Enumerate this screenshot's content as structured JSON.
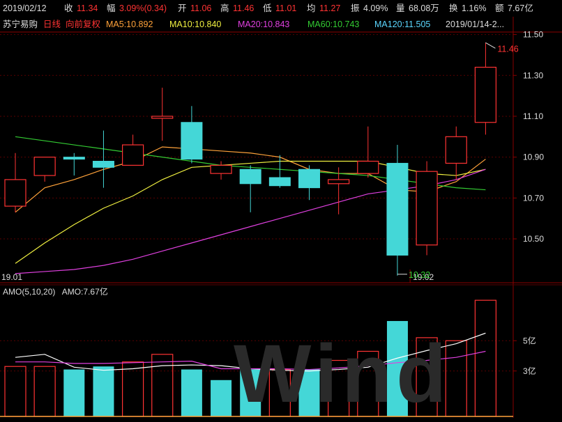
{
  "header": {
    "date": "2019/02/12",
    "close_label": "收",
    "close_value": "11.34",
    "change_label": "幅",
    "change_value": "3.09%(0.34)",
    "open_label": "开",
    "open_value": "11.06",
    "high_label": "高",
    "high_value": "11.46",
    "low_label": "低",
    "low_value": "11.01",
    "avg_label": "均",
    "avg_value": "11.27",
    "amp_label": "振",
    "amp_value": "4.09%",
    "vol_label": "量",
    "vol_value": "68.08万",
    "turn_label": "换",
    "turn_value": "1.16%",
    "amt_label": "额",
    "amt_value": "7.67亿"
  },
  "ma_bar": {
    "stock_name": "苏宁易购",
    "period": "日线",
    "adjust": "向前复权",
    "ma5": "MA5:10.892",
    "ma10": "MA10:10.840",
    "ma20": "MA20:10.843",
    "ma60": "MA60:10.743",
    "ma120": "MA120:11.505",
    "range": "2019/01/14-2..."
  },
  "amo_bar": {
    "params": "AMO(5,10,20)",
    "value": "AMO:7.67亿"
  },
  "annotations": {
    "high_marker": "11.46",
    "low_marker": "10.32"
  },
  "watermark": "Wind",
  "colors": {
    "up": "#ff3333",
    "down": "#44d7d7",
    "ma5": "#ffa23a",
    "ma10": "#f0f040",
    "ma20": "#e040e0",
    "ma60": "#33cc33",
    "ma120": "#5bd7ff",
    "grid": "#5a0000",
    "axis_text": "#dddddd"
  },
  "chart_data": [
    {
      "type": "candlestick",
      "title": "",
      "xlabel": "",
      "ylabel": "",
      "ylim": [
        10.35,
        11.56
      ],
      "y_ticks": [
        "11.50",
        "11.30",
        "11.10",
        "10.90",
        "10.70",
        "10.50"
      ],
      "x_tick_labels": [
        {
          "index": 0,
          "label": "19.01"
        },
        {
          "index": 14,
          "label": "19.02"
        }
      ],
      "candles": [
        {
          "open": 10.66,
          "close": 10.79,
          "high": 10.92,
          "low": 10.63
        },
        {
          "open": 10.81,
          "close": 10.9,
          "high": 10.9,
          "low": 10.78
        },
        {
          "open": 10.9,
          "close": 10.89,
          "high": 10.92,
          "low": 10.81
        },
        {
          "open": 10.88,
          "close": 10.85,
          "high": 11.03,
          "low": 10.75
        },
        {
          "open": 10.86,
          "close": 10.96,
          "high": 11.01,
          "low": 10.86
        },
        {
          "open": 11.09,
          "close": 11.1,
          "high": 11.24,
          "low": 10.98
        },
        {
          "open": 11.07,
          "close": 10.89,
          "high": 11.15,
          "low": 10.87
        },
        {
          "open": 10.82,
          "close": 10.86,
          "high": 10.88,
          "low": 10.79
        },
        {
          "open": 10.84,
          "close": 10.77,
          "high": 10.86,
          "low": 10.63
        },
        {
          "open": 10.8,
          "close": 10.76,
          "high": 10.91,
          "low": 10.75
        },
        {
          "open": 10.84,
          "close": 10.75,
          "high": 10.86,
          "low": 10.69
        },
        {
          "open": 10.77,
          "close": 10.79,
          "high": 10.85,
          "low": 10.62
        },
        {
          "open": 10.82,
          "close": 10.88,
          "high": 11.05,
          "low": 10.8
        },
        {
          "open": 10.87,
          "close": 10.42,
          "high": 10.96,
          "low": 10.32
        },
        {
          "open": 10.47,
          "close": 10.83,
          "high": 10.88,
          "low": 10.42
        },
        {
          "open": 10.87,
          "close": 11.0,
          "high": 11.05,
          "low": 10.79
        },
        {
          "open": 11.07,
          "close": 11.34,
          "high": 11.46,
          "low": 11.01
        }
      ],
      "ma_series": [
        {
          "name": "MA5",
          "values": [
            10.63,
            10.75,
            10.79,
            10.84,
            10.88,
            10.95,
            10.94,
            10.93,
            10.92,
            10.9,
            10.84,
            10.82,
            10.82,
            10.74,
            10.73,
            10.78,
            10.89
          ]
        },
        {
          "name": "MA10",
          "values": [
            10.38,
            10.48,
            10.57,
            10.65,
            10.71,
            10.79,
            10.85,
            10.86,
            10.87,
            10.88,
            10.88,
            10.88,
            10.88,
            10.85,
            10.82,
            10.81,
            10.84
          ]
        },
        {
          "name": "MA20",
          "values": [
            10.33,
            10.34,
            10.35,
            10.37,
            10.4,
            10.44,
            10.48,
            10.52,
            10.56,
            10.6,
            10.64,
            10.68,
            10.72,
            10.74,
            10.76,
            10.79,
            10.84
          ]
        },
        {
          "name": "MA60",
          "values": [
            11.0,
            10.98,
            10.96,
            10.94,
            10.92,
            10.9,
            10.88,
            10.86,
            10.85,
            10.84,
            10.83,
            10.82,
            10.81,
            10.79,
            10.77,
            10.75,
            10.74
          ]
        }
      ]
    },
    {
      "type": "bar",
      "title": "",
      "ylim": [
        0,
        8
      ],
      "y_ticks": [
        "5亿",
        "3亿"
      ],
      "bars": [
        {
          "value": 3.3,
          "up": true
        },
        {
          "value": 3.3,
          "up": true
        },
        {
          "value": 3.1,
          "up": false
        },
        {
          "value": 3.3,
          "up": false
        },
        {
          "value": 3.6,
          "up": true
        },
        {
          "value": 4.1,
          "up": true
        },
        {
          "value": 3.1,
          "up": false
        },
        {
          "value": 2.4,
          "up": false
        },
        {
          "value": 3.1,
          "up": false
        },
        {
          "value": 3.1,
          "up": true
        },
        {
          "value": 3.1,
          "up": false
        },
        {
          "value": 3.7,
          "up": true
        },
        {
          "value": 4.3,
          "up": true
        },
        {
          "value": 6.3,
          "up": false
        },
        {
          "value": 5.2,
          "up": true
        },
        {
          "value": 5.0,
          "up": true
        },
        {
          "value": 7.67,
          "up": true
        }
      ],
      "ma_series": [
        {
          "name": "AMO5",
          "values": [
            3.9,
            4.1,
            3.25,
            3.05,
            3.15,
            3.35,
            3.4,
            3.35,
            3.15,
            3.05,
            3.0,
            3.1,
            3.25,
            3.85,
            4.35,
            4.8,
            5.5
          ]
        },
        {
          "name": "AMO10",
          "values": [
            3.6,
            3.6,
            3.5,
            3.5,
            3.55,
            3.6,
            3.65,
            3.15,
            3.15,
            3.15,
            3.1,
            3.2,
            3.35,
            3.55,
            3.7,
            3.9,
            4.3
          ]
        }
      ]
    }
  ]
}
